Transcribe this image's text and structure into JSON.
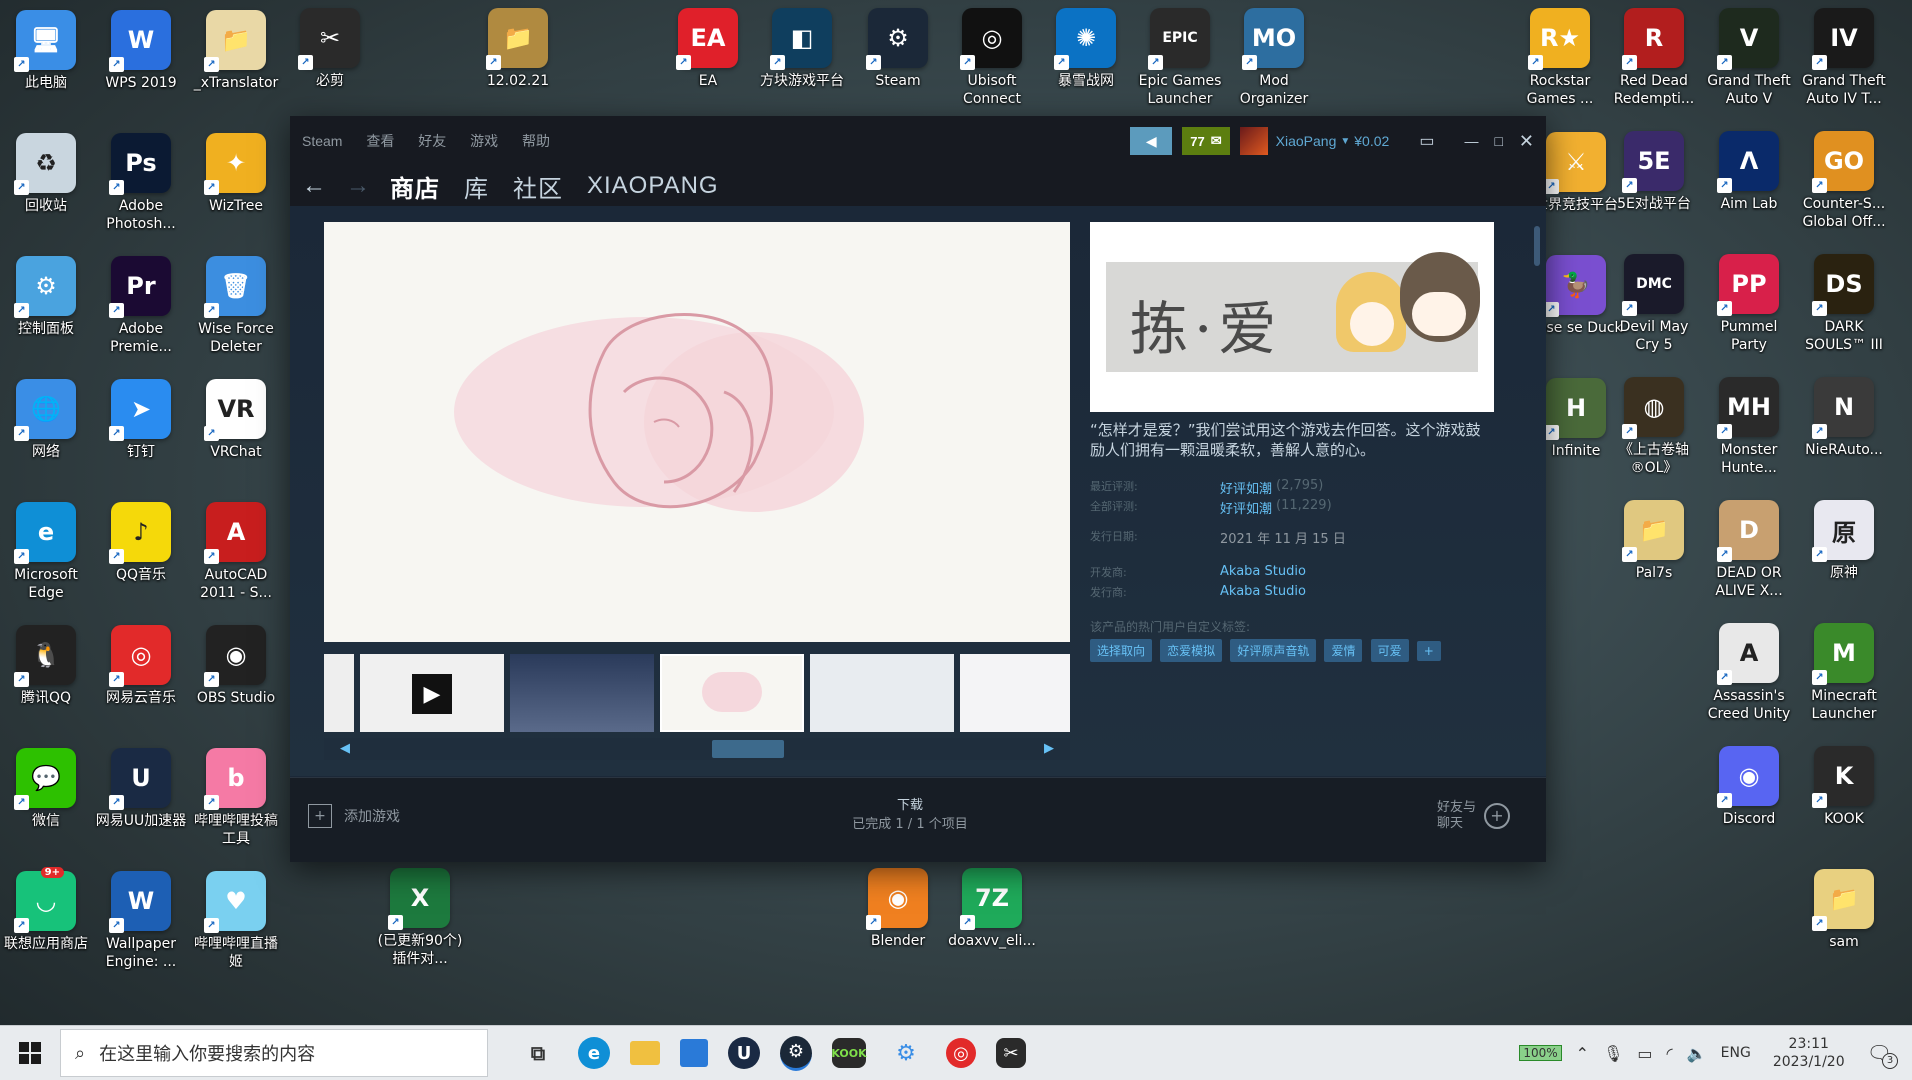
{
  "desktop": {
    "icons_left": [
      {
        "label": "此电脑",
        "color": "#3a8ee6",
        "glyph": "🖥"
      },
      {
        "label": "回收站",
        "color": "#c9d6df",
        "glyph": "♻"
      },
      {
        "label": "控制面板",
        "color": "#4aa3df",
        "glyph": "⚙"
      },
      {
        "label": "网络",
        "color": "#3a8ee6",
        "glyph": "🌐"
      },
      {
        "label": "Microsoft Edge",
        "color": "#0f8fd6",
        "glyph": "e"
      },
      {
        "label": "腾讯QQ",
        "color": "#222222",
        "glyph": "🐧"
      },
      {
        "label": "微信",
        "color": "#2dc100",
        "glyph": "💬"
      },
      {
        "label": "联想应用商店",
        "color": "#17c27a",
        "glyph": "◡"
      }
    ],
    "icons_col2": [
      {
        "label": "WPS 2019",
        "color": "#2a6fde",
        "glyph": "W"
      },
      {
        "label": "Adobe Photosh...",
        "color": "#0b1a33",
        "glyph": "Ps"
      },
      {
        "label": "Adobe Premie...",
        "color": "#1b0a33",
        "glyph": "Pr"
      },
      {
        "label": "钉钉",
        "color": "#2a8cf0",
        "glyph": "➤"
      },
      {
        "label": "QQ音乐",
        "color": "#f5d90a",
        "glyph": "♪"
      },
      {
        "label": "网易云音乐",
        "color": "#e22a2a",
        "glyph": "◎"
      },
      {
        "label": "网易UU加速器",
        "color": "#1a2a44",
        "glyph": "U"
      },
      {
        "label": "Wallpaper Engine: ...",
        "color": "#1d5fb4",
        "glyph": "W"
      }
    ],
    "icons_col3": [
      {
        "label": "_xTranslator",
        "color": "#e9d8a6",
        "glyph": "📁"
      },
      {
        "label": "WizTree",
        "color": "#f0b020",
        "glyph": "✦"
      },
      {
        "label": "Wise Force Deleter",
        "color": "#3c8ee0",
        "glyph": "🗑"
      },
      {
        "label": "VRChat",
        "color": "#ffffff",
        "glyph": "VR"
      },
      {
        "label": "AutoCAD 2011 - S...",
        "color": "#c81e1e",
        "glyph": "A"
      },
      {
        "label": "OBS Studio",
        "color": "#222222",
        "glyph": "◉"
      },
      {
        "label": "哔哩哔哩投稿工具",
        "color": "#f57aa5",
        "glyph": "b"
      },
      {
        "label": "哔哩哔哩直播姬",
        "color": "#7ad0f0",
        "glyph": "♥"
      }
    ],
    "icons_top": [
      {
        "label": "必剪",
        "color": "#2a2a2a",
        "glyph": "✂"
      },
      {
        "label": "12.02.21",
        "color": "#b08a40",
        "glyph": "📁"
      },
      {
        "label": "EA",
        "color": "#e0202a",
        "glyph": "EA"
      },
      {
        "label": "方块游戏平台",
        "color": "#0f3e5e",
        "glyph": "◧"
      },
      {
        "label": "Steam",
        "color": "#1b2838",
        "glyph": "⚙"
      },
      {
        "label": "Ubisoft Connect",
        "color": "#111111",
        "glyph": "◎"
      },
      {
        "label": "暴雪战网",
        "color": "#0b72c4",
        "glyph": "✺"
      },
      {
        "label": "Epic Games Launcher",
        "color": "#2a2a2a",
        "glyph": "EPIC"
      },
      {
        "label": "Mod Organizer",
        "color": "#2d6ea0",
        "glyph": "MO"
      }
    ],
    "icons_right_col1": [
      {
        "label": "世界竞技平台",
        "color": "#f2b030",
        "glyph": "⚔"
      },
      {
        "label": "oose se Duck",
        "color": "#7a4fd0",
        "glyph": "🦆"
      },
      {
        "label": "Infinite",
        "color": "#4a6a3a",
        "glyph": "H"
      }
    ],
    "icons_right_col2": [
      {
        "label": "Red Dead Redempti...",
        "color": "#b21e1e",
        "glyph": "R"
      },
      {
        "label": "5E对战平台",
        "color": "#3a2a6a",
        "glyph": "5E"
      },
      {
        "label": "Devil May Cry 5",
        "color": "#1a1a2a",
        "glyph": "DMC"
      },
      {
        "label": "《上古卷轴®OL》",
        "color": "#3a3020",
        "glyph": "◍"
      },
      {
        "label": "Pal7s",
        "color": "#e0c880",
        "glyph": "📁"
      }
    ],
    "icons_right_col3": [
      {
        "label": "Grand Theft Auto V",
        "color": "#1e2a1e",
        "glyph": "V"
      },
      {
        "label": "Aim Lab",
        "color": "#0a2a6a",
        "glyph": "Λ"
      },
      {
        "label": "Pummel Party",
        "color": "#d8204a",
        "glyph": "PP"
      },
      {
        "label": "Monster Hunte...",
        "color": "#2a2a2a",
        "glyph": "MH"
      },
      {
        "label": "DEAD OR ALIVE X...",
        "color": "#c8a070",
        "glyph": "D"
      },
      {
        "label": "Assassin's Creed Unity",
        "color": "#e8e8e8",
        "glyph": "A"
      },
      {
        "label": "Discord",
        "color": "#5865f2",
        "glyph": "◉"
      }
    ],
    "icons_right_col4": [
      {
        "label": "Grand Theft Auto IV T...",
        "color": "#1a1a1a",
        "glyph": "IV"
      },
      {
        "label": "Counter-S... Global Off...",
        "color": "#e09020",
        "glyph": "GO"
      },
      {
        "label": "DARK SOULS™ III",
        "color": "#2a2210",
        "glyph": "DS"
      },
      {
        "label": "NieRAuto...",
        "color": "#3a3a3a",
        "glyph": "N"
      },
      {
        "label": "原神",
        "color": "#e8e8f0",
        "glyph": "原"
      },
      {
        "label": "Minecraft Launcher",
        "color": "#3a8a2a",
        "glyph": "M"
      },
      {
        "label": "KOOK",
        "color": "#2a2a2a",
        "glyph": "K"
      },
      {
        "label": "sam",
        "color": "#e8d080",
        "glyph": "📁"
      }
    ],
    "icons_right_rockstar": {
      "label": "Rockstar Games ...",
      "color": "#f0b020",
      "glyph": "R★"
    },
    "icons_bottom": [
      {
        "label": "(已更新90个) 插件对...",
        "color": "#1d7a3e",
        "glyph": "X"
      },
      {
        "label": "Blender",
        "color": "#f08020",
        "glyph": "◉"
      },
      {
        "label": "doaxvv_eli...",
        "color": "#1faa5a",
        "glyph": "7Z"
      }
    ]
  },
  "steam": {
    "menu": [
      "Steam",
      "查看",
      "好友",
      "游戏",
      "帮助"
    ],
    "notify_count": "77",
    "username": "XiaoPang",
    "balance": "¥0.02",
    "nav_tabs": [
      "商店",
      "库",
      "社区",
      "XIAOPANG"
    ],
    "game": {
      "capsule_title": "拣·爱",
      "description": "“怎样才是爱？”我们尝试用这个游戏去作回答。这个游戏鼓励人们拥有一颗温暖柔软，善解人意的心。",
      "recent_reviews_label": "最近评测:",
      "recent_reviews_value": "好评如潮",
      "recent_reviews_count": "(2,795)",
      "all_reviews_label": "全部评测:",
      "all_reviews_value": "好评如潮",
      "all_reviews_count": "(11,229)",
      "release_label": "发行日期:",
      "release_date": "2021 年 11 月 15 日",
      "developer_label": "开发商:",
      "developer": "Akaba Studio",
      "publisher_label": "发行商:",
      "publisher": "Akaba Studio",
      "tags_label": "该产品的热门用户自定义标签:",
      "tags": [
        "选择取向",
        "恋爱模拟",
        "好评原声音轨",
        "爱情",
        "可爱",
        "+"
      ]
    },
    "bottom": {
      "add_game": "添加游戏",
      "download_title": "下载",
      "download_status": "已完成 1 / 1 个项目",
      "friends_chat": "好友与\n聊天"
    }
  },
  "taskbar": {
    "search_placeholder": "在这里输入你要搜索的内容",
    "battery": "100%",
    "language": "ENG",
    "time": "23:11",
    "date": "2023/1/20",
    "notification_count": "3"
  }
}
